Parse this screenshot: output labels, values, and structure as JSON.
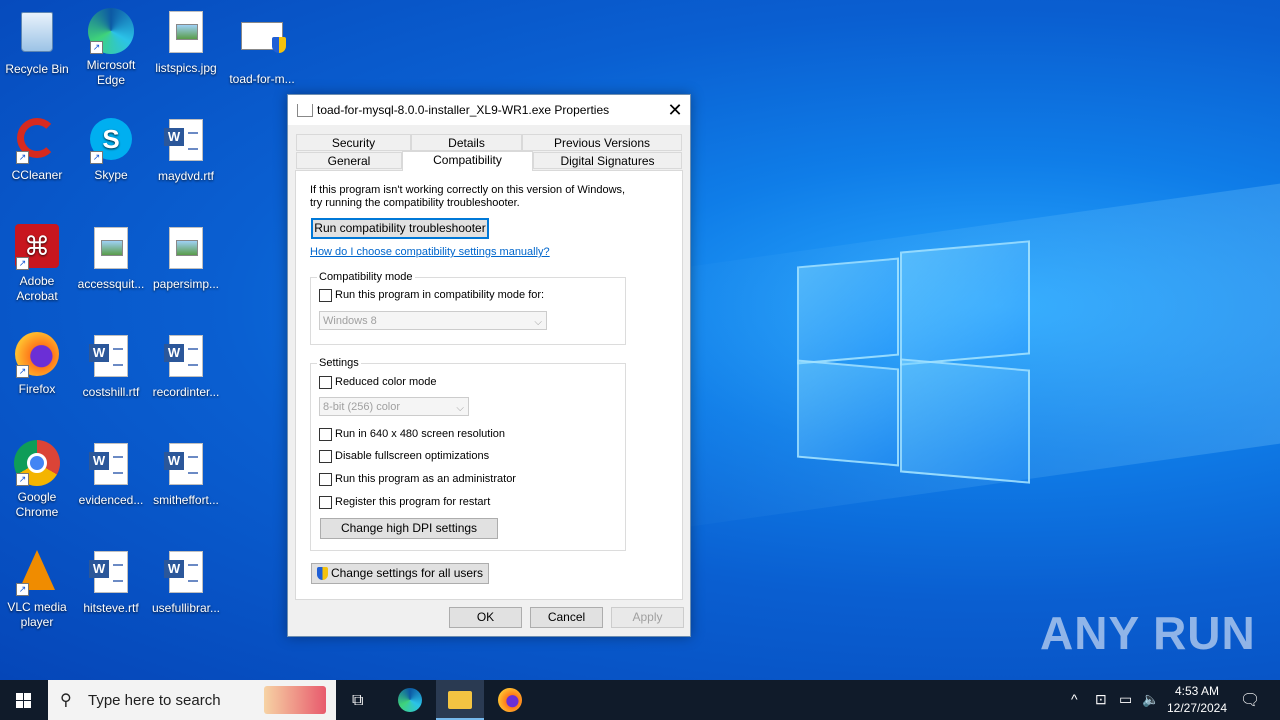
{
  "desktop": {
    "icons": [
      {
        "label": "Recycle Bin"
      },
      {
        "label": "Microsoft Edge"
      },
      {
        "label": "listspics.jpg"
      },
      {
        "label": "toad-for-m..."
      },
      {
        "label": "CCleaner"
      },
      {
        "label": "Skype"
      },
      {
        "label": "maydvd.rtf"
      },
      {
        "label": "Adobe Acrobat"
      },
      {
        "label": "accessquit..."
      },
      {
        "label": "papersimp..."
      },
      {
        "label": "Firefox"
      },
      {
        "label": "costshill.rtf"
      },
      {
        "label": "recordinter..."
      },
      {
        "label": "Google Chrome"
      },
      {
        "label": "evidenced..."
      },
      {
        "label": "smitheffort..."
      },
      {
        "label": "VLC media player"
      },
      {
        "label": "hitsteve.rtf"
      },
      {
        "label": "usefullibrar..."
      }
    ]
  },
  "dialog": {
    "title": "toad-for-mysql-8.0.0-installer_XL9-WR1.exe Properties",
    "tabs_row1": [
      "Security",
      "Details",
      "Previous Versions"
    ],
    "tabs_row2": [
      "General",
      "Compatibility",
      "Digital Signatures"
    ],
    "active_tab": "Compatibility",
    "intro_line1": "If this program isn't working correctly on this version of Windows,",
    "intro_line2": "try running the compatibility troubleshooter.",
    "troubleshooter_button": "Run compatibility troubleshooter",
    "manual_link": "How do I choose compatibility settings manually?",
    "compat_group": "Compatibility mode",
    "compat_checkbox": "Run this program in compatibility mode for:",
    "compat_select": "Windows 8",
    "settings_group": "Settings",
    "reduced_color": "Reduced color mode",
    "color_select": "8-bit (256) color",
    "run_640": "Run in 640 x 480 screen resolution",
    "disable_fullscreen": "Disable fullscreen optimizations",
    "run_admin": "Run this program as an administrator",
    "register_restart": "Register this program for restart",
    "dpi_button": "Change high DPI settings",
    "all_users_button": "Change settings for all users",
    "ok": "OK",
    "cancel": "Cancel",
    "apply": "Apply"
  },
  "taskbar": {
    "search_placeholder": "Type here to search",
    "time": "4:53 AM",
    "date": "12/27/2024"
  },
  "watermark": "ANY RUN",
  "colors": {
    "accent": "#0078d7",
    "link": "#0066cc",
    "desktop": "#0a5fd1",
    "taskbar": "#101b2a"
  }
}
